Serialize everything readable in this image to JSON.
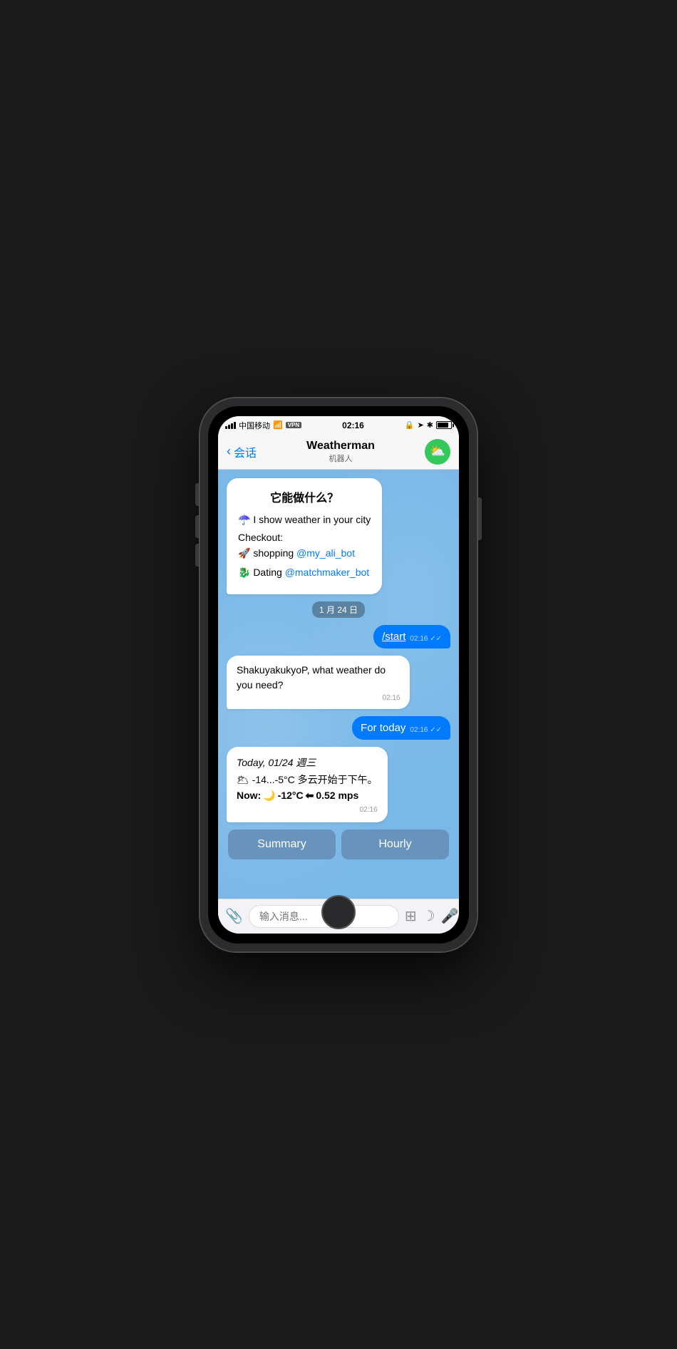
{
  "status_bar": {
    "carrier": "中国移动",
    "wifi": "WiFi",
    "vpn": "VPN",
    "time": "02:16",
    "lock_icon": "🔒",
    "location_icon": "➤",
    "bluetooth_icon": "✱"
  },
  "nav": {
    "back_label": "会话",
    "title": "Weatherman",
    "subtitle": "机器人",
    "avatar_icon": "⛅"
  },
  "chat": {
    "welcome_title": "它能做什么？",
    "welcome_line1": "☂️ I show weather in your city",
    "checkout_label": "Checkout:",
    "checkout_shopping": "🚀 shopping",
    "checkout_shopping_link": "@my_ali_bot",
    "checkout_dating": "🐉 Dating",
    "checkout_dating_link": "@matchmaker_bot",
    "date_divider": "1 月 24 日",
    "user_msg1": "/start",
    "user_msg1_time": "02:16",
    "bot_reply1": "ShakuyakukyoP, what weather do you need?",
    "bot_reply1_time": "02:16",
    "user_msg2": "For today",
    "user_msg2_time": "02:16",
    "weather_date": "Today, 01/24 週三",
    "weather_temp_line": "🌥 -14...-5°C 多云开始于下午。",
    "weather_now_label": "Now:",
    "weather_now_emoji": "🌙",
    "weather_now_temp": "-12°C",
    "weather_wind_emoji": "⬅",
    "weather_wind": "0.52 mps",
    "weather_time": "02:16",
    "summary_btn": "Summary",
    "hourly_btn": "Hourly"
  },
  "input_bar": {
    "placeholder": "输入消息..."
  }
}
